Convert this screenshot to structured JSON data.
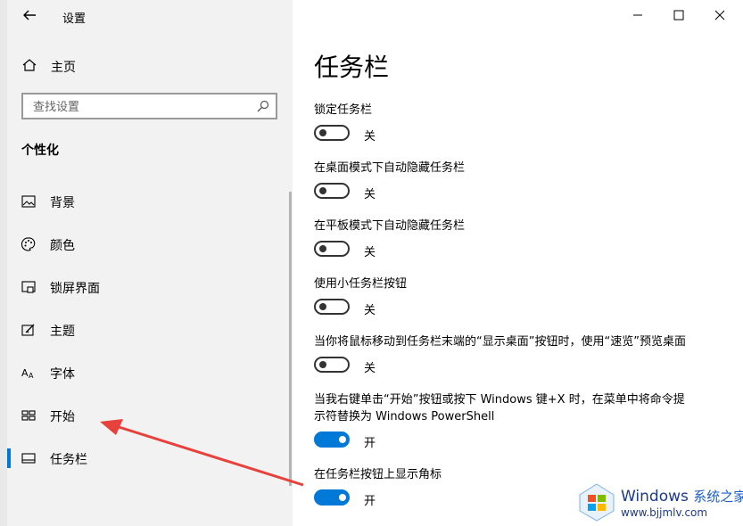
{
  "window": {
    "title": "设置",
    "controls": [
      "minimize",
      "maximize",
      "close"
    ]
  },
  "sidebar": {
    "home_label": "主页",
    "search": {
      "placeholder": "查找设置",
      "value": ""
    },
    "section_title": "个性化",
    "items": [
      {
        "label": "背景",
        "icon": "image-icon"
      },
      {
        "label": "颜色",
        "icon": "palette-icon"
      },
      {
        "label": "锁屏界面",
        "icon": "lock-screen-icon"
      },
      {
        "label": "主题",
        "icon": "theme-icon"
      },
      {
        "label": "字体",
        "icon": "font-icon"
      },
      {
        "label": "开始",
        "icon": "start-icon"
      },
      {
        "label": "任务栏",
        "icon": "taskbar-icon",
        "selected": true
      }
    ]
  },
  "main": {
    "title": "任务栏",
    "settings": [
      {
        "label": "锁定任务栏",
        "state": "关",
        "on": false
      },
      {
        "label": "在桌面模式下自动隐藏任务栏",
        "state": "关",
        "on": false
      },
      {
        "label": "在平板模式下自动隐藏任务栏",
        "state": "关",
        "on": false
      },
      {
        "label": "使用小任务栏按钮",
        "state": "关",
        "on": false
      },
      {
        "label": "当你将鼠标移动到任务栏末端的“显示桌面”按钮时，使用“速览”预览桌面",
        "state": "关",
        "on": false
      },
      {
        "label_line1": "当我右键单击“开始”按钮或按下 Windows 键+X 时，在菜单中将命令提",
        "label_line2": "示符替换为 Windows PowerShell",
        "state": "开",
        "on": true
      },
      {
        "label": "在任务栏按钮上显示角标",
        "state": "开",
        "on": true
      }
    ]
  },
  "watermark": {
    "brand": "Windows",
    "brand_cn": "系统之家",
    "url": "www.bjjmlv.com"
  },
  "colors": {
    "accent": "#0078d7",
    "sidebar_bg": "#f2f2f2",
    "arrow": "#e8403a"
  }
}
